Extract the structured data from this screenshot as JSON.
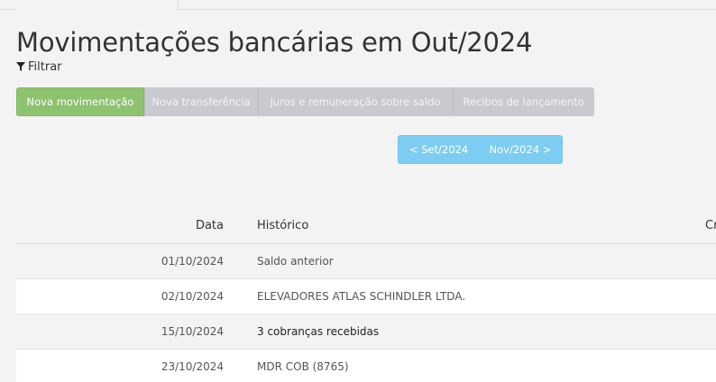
{
  "page": {
    "title": "Movimentações bancárias em Out/2024",
    "filter_label": "Filtrar"
  },
  "actions": {
    "new_movement": "Nova movimentação",
    "new_transfer": "Nova transferência",
    "interest": "Juros e remuneração sobre saldo",
    "receipts": "Recibos de lançamento"
  },
  "month_nav": {
    "prev": "< Set/2024",
    "next": "Nov/2024 >"
  },
  "table": {
    "headers": {
      "date": "Data",
      "history": "Histórico",
      "credit": "Cr"
    },
    "rows": [
      {
        "date": "01/10/2024",
        "history": "Saldo anterior"
      },
      {
        "date": "02/10/2024",
        "history": "ELEVADORES ATLAS SCHINDLER LTDA."
      },
      {
        "date": "15/10/2024",
        "history": "3 cobranças recebidas"
      },
      {
        "date": "23/10/2024",
        "history": "MDR COB (8765)"
      }
    ]
  },
  "colors": {
    "primary_green": "#8dc26f",
    "nav_blue": "#7ccdf1",
    "disabled_grey": "#c9c9d0"
  },
  "icons": {
    "filter": "filter-funnel-icon"
  }
}
